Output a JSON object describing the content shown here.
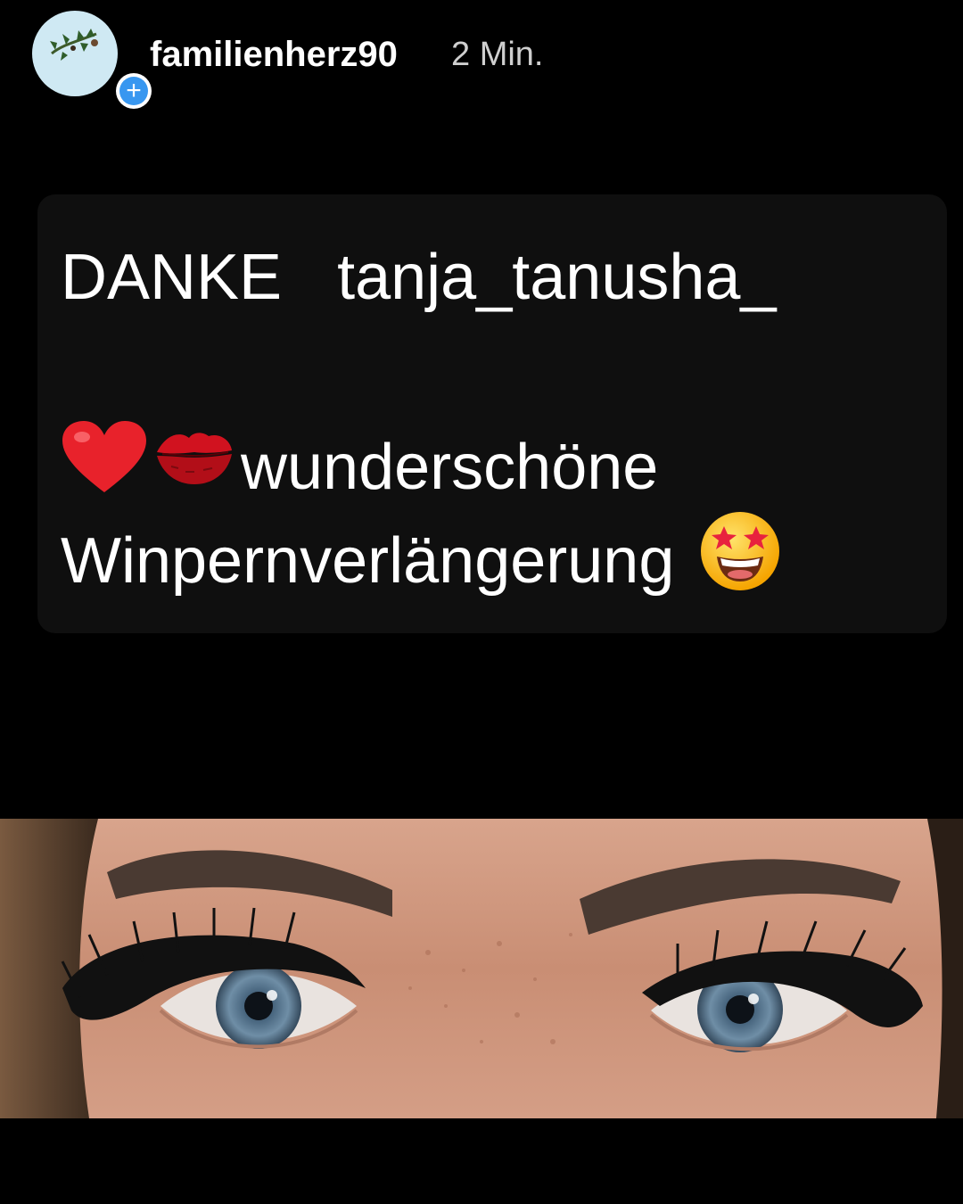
{
  "story_header": {
    "username": "familienherz90",
    "time_ago": "2 Min.",
    "add_badge": "+",
    "avatar_icon": "holly-sprig-icon"
  },
  "text_card": {
    "line1_word1": "DANKE",
    "line1_word2": "tanja_tanusha_",
    "line2_text": "wunderschöne",
    "line3_text": "Winpernverlängerung",
    "emojis": [
      "red-heart-icon",
      "kiss-mark-icon",
      "star-struck-face-icon"
    ]
  },
  "photo": {
    "icon": "eyelash-extension-photo"
  },
  "colors": {
    "background": "#000000",
    "card": "#0f0f0f",
    "badge": "#3897f0",
    "avatar": "#cfe9f3"
  }
}
